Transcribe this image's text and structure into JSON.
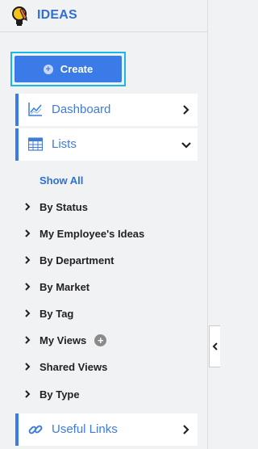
{
  "app": {
    "title": "IDEAS"
  },
  "create_button": {
    "label": "Create"
  },
  "nav": {
    "dashboard": {
      "label": "Dashboard"
    },
    "lists": {
      "label": "Lists"
    },
    "useful_links": {
      "label": "Useful Links"
    }
  },
  "lists_menu": {
    "show_all": "Show All",
    "items": [
      {
        "label": "By Status"
      },
      {
        "label": "My Employee's Ideas"
      },
      {
        "label": "By Department"
      },
      {
        "label": "By Market"
      },
      {
        "label": "By Tag"
      },
      {
        "label": "My Views"
      },
      {
        "label": "Shared Views"
      },
      {
        "label": "By Type"
      }
    ]
  },
  "colors": {
    "accent": "#3b7be8",
    "focus_ring": "#19b6e8",
    "title_blue": "#2f6fd6",
    "background": "#f1f2f4"
  },
  "icons": {
    "logo": "lightbulb-icon",
    "create": "plus-circle-icon",
    "dashboard": "line-chart-icon",
    "lists": "table-icon",
    "useful_links": "link-icon",
    "my_views_add": "add-circle-icon",
    "collapse": "chevron-left-icon"
  }
}
